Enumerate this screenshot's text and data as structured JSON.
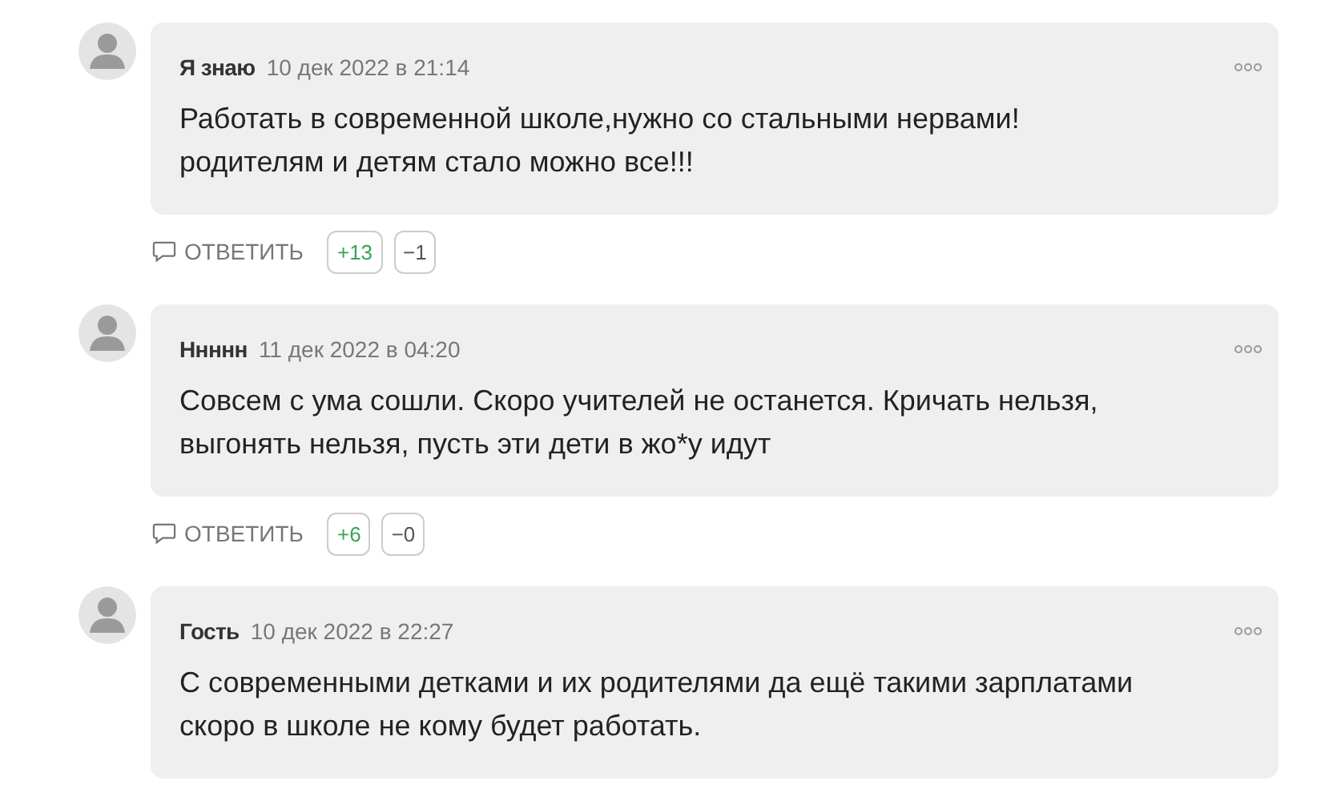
{
  "comments": [
    {
      "author": "Я знаю",
      "date": "10 дек 2022 в 21:14",
      "text": "Работать в современной школе,нужно со стальными нервами!\nродителям и детям стало можно все!!!",
      "reply": "ОТВЕТИТЬ",
      "plus": "+13",
      "minus": "−1"
    },
    {
      "author": "Ннннн",
      "date": "11 дек 2022 в 04:20",
      "text": "Совсем с ума сошли. Скоро учителей не останется. Кричать нельзя,\nвыгонять нельзя, пусть эти дети в жо*у идут",
      "reply": "ОТВЕТИТЬ",
      "plus": "+6",
      "minus": "−0"
    },
    {
      "author": "Гость",
      "date": "10 дек 2022 в 22:27",
      "text": "С современными детками и их родителями да ещё такими зарплатами\nскоро в школе не кому будет работать."
    }
  ]
}
